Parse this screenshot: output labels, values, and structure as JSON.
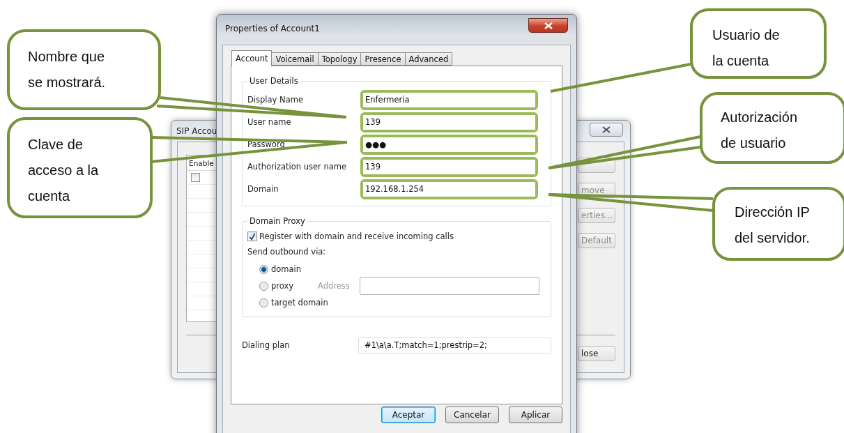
{
  "background_window": {
    "title": "SIP Accou",
    "column": "Enable",
    "rows": [
      {
        "checked": false
      }
    ],
    "buttons": [
      {
        "label": "move"
      },
      {
        "label": "erties..."
      },
      {
        "label": "Default"
      },
      {
        "label": "lose"
      }
    ]
  },
  "dialog": {
    "title": "Properties of Account1",
    "tabs": [
      {
        "label": "Account",
        "selected": true
      },
      {
        "label": "Voicemail",
        "selected": false
      },
      {
        "label": "Topology",
        "selected": false
      },
      {
        "label": "Presence",
        "selected": false
      },
      {
        "label": "Advanced",
        "selected": false
      }
    ],
    "user_details": {
      "title": "User Details",
      "fields": [
        {
          "label": "Display Name",
          "value": "Enfermeria",
          "highlighted": true
        },
        {
          "label": "User name",
          "value": "139",
          "highlighted": true
        },
        {
          "label": "Password",
          "value": "●●●",
          "highlighted": true
        },
        {
          "label": "Authorization user name",
          "value": "139",
          "highlighted": true
        },
        {
          "label": "Domain",
          "value": "192.168.1.254",
          "highlighted": true
        }
      ]
    },
    "domain_proxy": {
      "title": "Domain Proxy",
      "register": {
        "label": "Register with domain and receive incoming calls",
        "checked": true
      },
      "send_label": "Send outbound via:",
      "options": [
        {
          "label": "domain",
          "selected": true
        },
        {
          "label": "proxy",
          "selected": false
        },
        {
          "label": "target domain",
          "selected": false
        }
      ],
      "address": {
        "label": "Address",
        "disabled": true
      }
    },
    "dialing_plan": {
      "label": "Dialing plan",
      "value": "#1\\a\\a.T;match=1;prestrip=2;"
    },
    "buttons": [
      {
        "label": "Aceptar",
        "default": true
      },
      {
        "label": "Cancelar",
        "default": false
      },
      {
        "label": "Aplicar",
        "default": false
      }
    ]
  },
  "callouts": [
    {
      "text": "Nombre que\nse mostrará."
    },
    {
      "text": "Clave de\nacceso a la\ncuenta"
    },
    {
      "text": "Usuario de\nla cuenta"
    },
    {
      "text": "Autorización\nde usuario"
    },
    {
      "text": "Dirección IP\ndel servidor."
    }
  ]
}
